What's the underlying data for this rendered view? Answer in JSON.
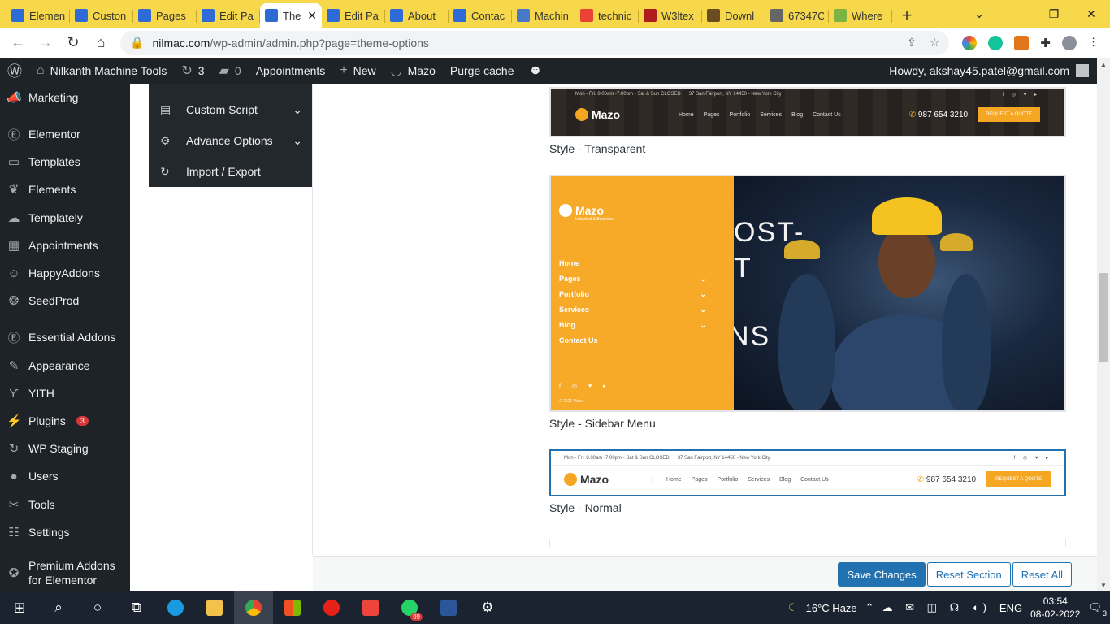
{
  "browser": {
    "tabs": [
      {
        "title": "Elemen",
        "color": "#2e6bd6"
      },
      {
        "title": "Custon",
        "color": "#2e6bd6"
      },
      {
        "title": "Pages",
        "color": "#2e6bd6"
      },
      {
        "title": "Edit Pa",
        "color": "#2e6bd6"
      },
      {
        "title": "The",
        "color": "#2e6bd6",
        "active": true
      },
      {
        "title": "Edit Pa",
        "color": "#2e6bd6"
      },
      {
        "title": "About",
        "color": "#2e6bd6"
      },
      {
        "title": "Contac",
        "color": "#2e6bd6"
      },
      {
        "title": "Machin",
        "color": "#4a78c9"
      },
      {
        "title": "technic",
        "color": "#ea4335"
      },
      {
        "title": "W3ltex",
        "color": "#b01c1c"
      },
      {
        "title": "Downl",
        "color": "#6b4c1e"
      },
      {
        "title": "67347C",
        "color": "#666666"
      },
      {
        "title": "Where",
        "color": "#7cb342"
      }
    ],
    "url_domain": "nilmac.com",
    "url_path": "/wp-admin/admin.php?page=theme-options"
  },
  "adminbar": {
    "site_name": "Nilkanth Machine Tools",
    "updates_count": "3",
    "comments_count": "0",
    "appointments": "Appointments",
    "new": "New",
    "theme": "Mazo",
    "purge": "Purge cache",
    "howdy": "Howdy, akshay45.patel@gmail.com"
  },
  "wpmenu": {
    "items": [
      {
        "label": "Marketing",
        "icon": "megaphone-icon"
      },
      {
        "label": "Elementor",
        "icon": "elementor-icon"
      },
      {
        "label": "Templates",
        "icon": "folder-icon"
      },
      {
        "label": "Elements",
        "icon": "leaf-icon"
      },
      {
        "label": "Templately",
        "icon": "templately-icon"
      },
      {
        "label": "Appointments",
        "icon": "calendar-icon"
      },
      {
        "label": "HappyAddons",
        "icon": "happy-icon"
      },
      {
        "label": "SeedProd",
        "icon": "seedprod-icon"
      },
      {
        "label": "Essential Addons",
        "icon": "ea-icon"
      },
      {
        "label": "Appearance",
        "icon": "brush-icon"
      },
      {
        "label": "YITH",
        "icon": "yith-icon"
      },
      {
        "label": "Plugins",
        "icon": "plug-icon",
        "badge": "3"
      },
      {
        "label": "WP Staging",
        "icon": "refresh-icon"
      },
      {
        "label": "Users",
        "icon": "user-icon"
      },
      {
        "label": "Tools",
        "icon": "wrench-icon"
      },
      {
        "label": "Settings",
        "icon": "settings-icon"
      }
    ],
    "premium_line1": "Premium Addons",
    "premium_line2": "for Elementor"
  },
  "options_nav": [
    {
      "label": "Custom Script",
      "icon": "script-icon",
      "chevron": true
    },
    {
      "label": "Advance Options",
      "icon": "gears-icon",
      "chevron": true
    },
    {
      "label": "Import / Export",
      "icon": "refresh-icon",
      "chevron": false
    }
  ],
  "header_styles": [
    {
      "caption": "Style - Transparent",
      "selected": false
    },
    {
      "caption": "Style - Sidebar Menu",
      "selected": false
    },
    {
      "caption": "Style - Normal",
      "selected": true
    }
  ],
  "preview": {
    "topbar_hours": "Mon - Fri: 8.00am -7.00pm - Sat & Sun CLOSED",
    "topbar_address": "37 San Fairport, NY 14450 - New York City",
    "brand": "Mazo",
    "brand_tag": "Industrial & Business",
    "nav": [
      "Home",
      "Pages",
      "Portfolio",
      "Services",
      "Blog",
      "Contact Us"
    ],
    "phone": "987 654 3210",
    "quote": "REQUEST A QUOTE",
    "sidebar_items": [
      "Home",
      "Pages",
      "Portfolio",
      "Services",
      "Blog",
      "Contact Us"
    ],
    "copyright": "© 2021 Mazo",
    "hero_line1": "OST-",
    "hero_line2": "T",
    "hero_line3": "NS"
  },
  "actions": {
    "save": "Save Changes",
    "reset_section": "Reset Section",
    "reset_all": "Reset All"
  },
  "taskbar": {
    "weather": "16°C  Haze",
    "lang": "ENG",
    "time": "03:54",
    "date": "08-02-2022",
    "whatsapp_badge": "99",
    "notif_count": "3"
  }
}
